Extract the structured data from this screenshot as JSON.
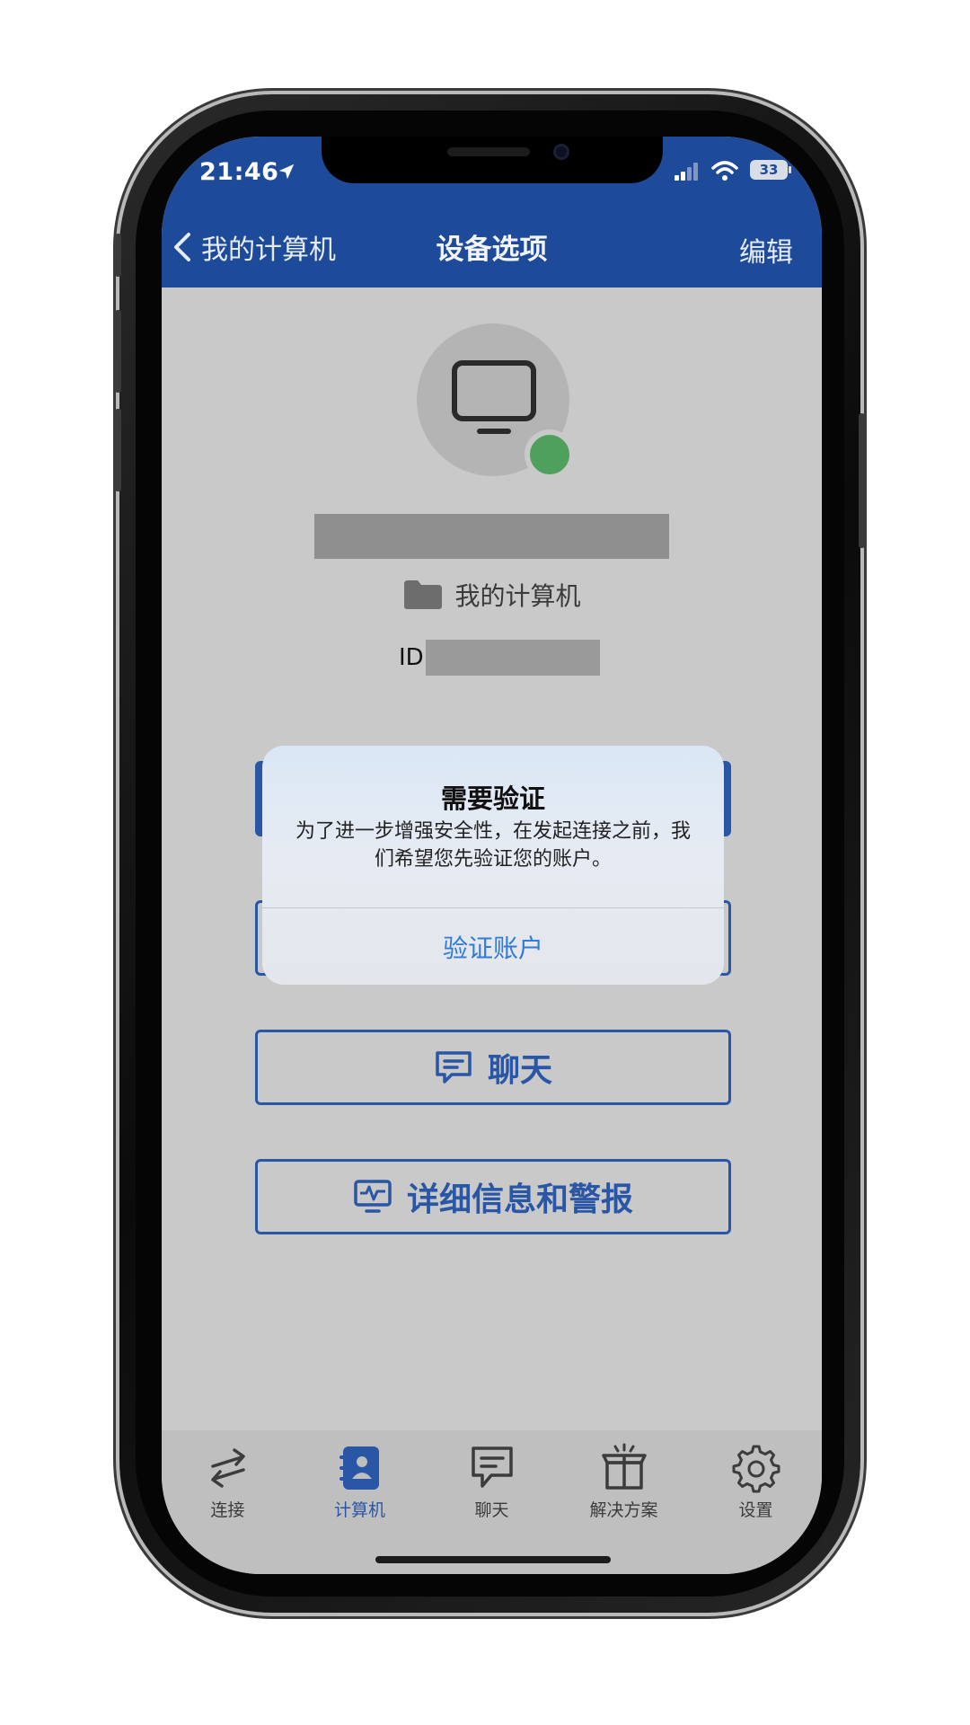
{
  "status_bar": {
    "time": "21:46",
    "battery": "33",
    "icons": [
      "location-arrow-icon",
      "signal-icon",
      "wifi-icon",
      "battery-icon"
    ]
  },
  "nav": {
    "back_label": "我的计算机",
    "title": "设备选项",
    "edit_label": "编辑"
  },
  "device": {
    "group": "我的计算机",
    "id_label": "ID",
    "status_color": "#4f9f5d"
  },
  "buttons": {
    "chat": "聊天",
    "details": "详细信息和警报"
  },
  "dialog": {
    "title": "需要验证",
    "message": "为了进一步增强安全性，在发起连接之前，我们希望您先验证您的账户。",
    "action": "验证账户"
  },
  "tabs": [
    {
      "label": "连接",
      "icon": "transfer-arrows-icon",
      "active": false
    },
    {
      "label": "计算机",
      "icon": "contacts-book-icon",
      "active": true
    },
    {
      "label": "聊天",
      "icon": "chat-bubble-icon",
      "active": false
    },
    {
      "label": "解决方案",
      "icon": "gift-box-icon",
      "active": false
    },
    {
      "label": "设置",
      "icon": "gear-icon",
      "active": false
    }
  ],
  "colors": {
    "brand": "#1e4a9a",
    "accent": "#2a56a6",
    "link": "#2f7bd6"
  }
}
